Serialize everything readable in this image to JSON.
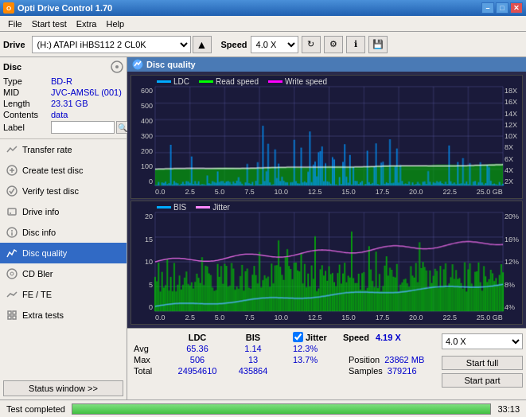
{
  "titlebar": {
    "title": "Opti Drive Control 1.70",
    "icon": "O",
    "minimize_label": "–",
    "maximize_label": "□",
    "close_label": "✕"
  },
  "menubar": {
    "items": [
      "File",
      "Start test",
      "Extra",
      "Help"
    ]
  },
  "toolbar": {
    "drive_label": "Drive",
    "drive_value": "(H:)  ATAPI iHBS112  2 CL0K",
    "speed_label": "Speed",
    "speed_value": "4.0 X"
  },
  "sidebar": {
    "disc_title": "Disc",
    "disc_type_label": "Type",
    "disc_type_value": "BD-R",
    "disc_mid_label": "MID",
    "disc_mid_value": "JVC-AMS6L (001)",
    "disc_length_label": "Length",
    "disc_length_value": "23.31 GB",
    "disc_contents_label": "Contents",
    "disc_contents_value": "data",
    "disc_label_label": "Label",
    "nav_items": [
      {
        "id": "transfer-rate",
        "label": "Transfer rate",
        "active": false
      },
      {
        "id": "create-test-disc",
        "label": "Create test disc",
        "active": false
      },
      {
        "id": "verify-test-disc",
        "label": "Verify test disc",
        "active": false
      },
      {
        "id": "drive-info",
        "label": "Drive info",
        "active": false
      },
      {
        "id": "disc-info",
        "label": "Disc info",
        "active": false
      },
      {
        "id": "disc-quality",
        "label": "Disc quality",
        "active": true
      },
      {
        "id": "cd-bler",
        "label": "CD Bler",
        "active": false
      },
      {
        "id": "fe-te",
        "label": "FE / TE",
        "active": false
      },
      {
        "id": "extra-tests",
        "label": "Extra tests",
        "active": false
      }
    ],
    "status_btn_label": "Status window >>"
  },
  "content": {
    "title": "Disc quality",
    "chart1": {
      "legend": [
        {
          "label": "LDC",
          "color": "#00aaff"
        },
        {
          "label": "Read speed",
          "color": "#00ff00"
        },
        {
          "label": "Write speed",
          "color": "#ff00ff"
        }
      ],
      "yaxis": [
        "600",
        "500",
        "400",
        "300",
        "200",
        "100",
        "0"
      ],
      "yaxis_right": [
        "18X",
        "16X",
        "14X",
        "12X",
        "10X",
        "8X",
        "6X",
        "4X",
        "2X"
      ],
      "xaxis": [
        "0.0",
        "2.5",
        "5.0",
        "7.5",
        "10.0",
        "12.5",
        "15.0",
        "17.5",
        "20.0",
        "22.5",
        "25.0 GB"
      ]
    },
    "chart2": {
      "legend": [
        {
          "label": "BIS",
          "color": "#00aaff"
        },
        {
          "label": "Jitter",
          "color": "#ff88ff"
        }
      ],
      "yaxis": [
        "20",
        "15",
        "10",
        "5",
        "0"
      ],
      "yaxis_right": [
        "20%",
        "16%",
        "12%",
        "8%",
        "4%"
      ],
      "xaxis": [
        "0.0",
        "2.5",
        "5.0",
        "7.5",
        "10.0",
        "12.5",
        "15.0",
        "17.5",
        "20.0",
        "22.5",
        "25.0 GB"
      ]
    }
  },
  "stats": {
    "headers": [
      "LDC",
      "BIS",
      "",
      "Jitter",
      "Speed",
      "4.19 X",
      "4.0 X"
    ],
    "avg_label": "Avg",
    "avg_ldc": "65.36",
    "avg_bis": "1.14",
    "avg_jitter": "12.3%",
    "max_label": "Max",
    "max_ldc": "506",
    "max_bis": "13",
    "max_jitter": "13.7%",
    "position_label": "Position",
    "position_value": "23862 MB",
    "total_label": "Total",
    "total_ldc": "24954610",
    "total_bis": "435864",
    "samples_label": "Samples",
    "samples_value": "379216",
    "jitter_checked": true,
    "btn_start_full": "Start full",
    "btn_start_part": "Start part",
    "speed_select": "4.0 X"
  },
  "statusbar": {
    "status_text": "Test completed",
    "progress": 100,
    "time": "33:13"
  }
}
